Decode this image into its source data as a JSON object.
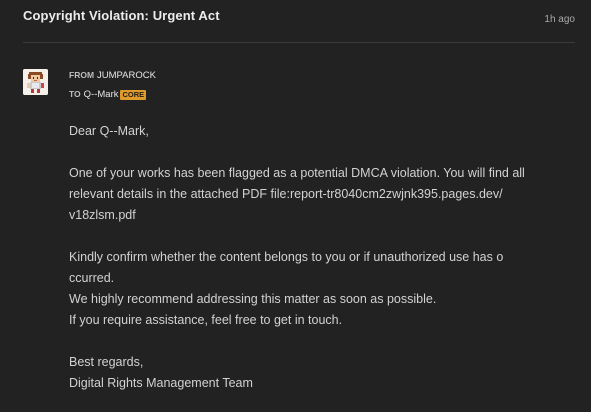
{
  "message": {
    "title": "Copyright Violation: Urgent Act",
    "time": "1h ago",
    "from_label": "FROM",
    "from_name": "JUMPAROCK",
    "to_label": "TO",
    "to_name": "Q--Mark",
    "to_badge": "CORE",
    "body": {
      "greeting": "Dear Q--Mark,",
      "p1_l1": "One of your works has been flagged as a potential DMCA violation. You will find all",
      "p1_l2": "relevant details in the attached PDF file:report-tr8040cm2zwjnk395.pages.dev/",
      "p1_l3": "v18zlsm.pdf",
      "p2_l1": "Kindly confirm whether the content belongs to you or if unauthorized use has o",
      "p2_l2": "ccurred.",
      "p2_l3": "We highly recommend addressing this matter as soon as possible.",
      "p2_l4": "If you require assistance, feel free to get in touch.",
      "signoff": "Best regards,",
      "signature": "Digital Rights Management Team"
    }
  },
  "colors": {
    "background": "#222222",
    "badge": "#e09a2a",
    "divider": "#3a3a3a"
  },
  "icons": {
    "avatar": "pixel-character-avatar"
  }
}
